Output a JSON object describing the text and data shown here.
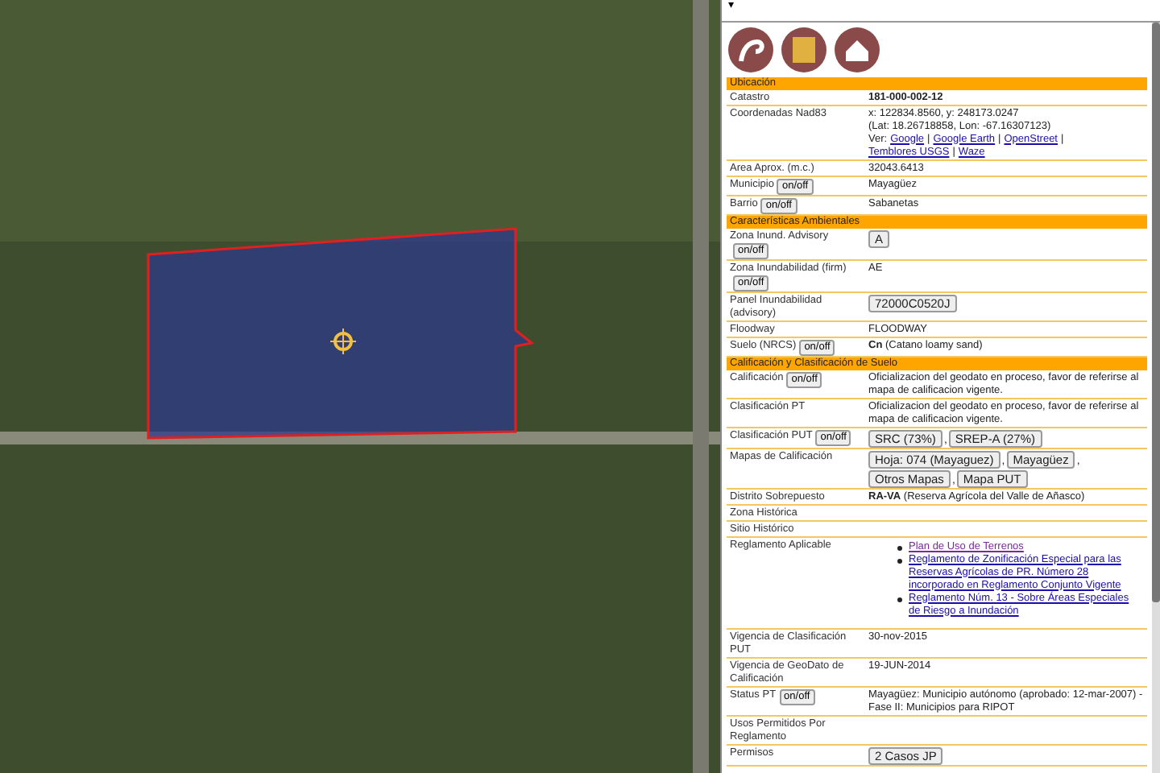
{
  "panel_toggle": "▾",
  "sections": [
    {
      "title": "Ubicación",
      "rows": [
        {
          "label": "Catastro",
          "value": "**181-000-002-12**"
        },
        {
          "label": "Coordenadas Nad83",
          "lines": [
            "x: 122834.8560, y: 248173.0247",
            "(Lat: 18.26718858, Lon: -67.16307123)"
          ],
          "inline_links": {
            "prefix": "Ver:",
            "separator": "|",
            "items": [
              "Google",
              "Google Earth",
              "OpenStreet",
              "Temblores USGS",
              "Waze"
            ]
          }
        },
        {
          "label": "Area Aprox. (m.c.)",
          "value": "32043.6413"
        },
        {
          "label": "Municipio",
          "toggle": "on/off",
          "value": "Mayagüez"
        },
        {
          "label": "Barrio",
          "toggle": "on/off",
          "value": "Sabanetas"
        }
      ]
    },
    {
      "title": "Características Ambientales",
      "rows": [
        {
          "label": "Zona Inund. Advisory",
          "toggle": "on/off",
          "buttons": [
            "A"
          ]
        },
        {
          "label": "Zona Inundabilidad (firm)",
          "toggle": "on/off",
          "value": "AE"
        },
        {
          "label": "Panel Inundabilidad (advisory)",
          "buttons": [
            "72000C0520J"
          ]
        },
        {
          "label": "Floodway",
          "value": "FLOODWAY"
        },
        {
          "label": "Suelo (NRCS)",
          "toggle": "on/off",
          "value": "**Cn** (Catano loamy sand)"
        }
      ]
    },
    {
      "title": "Calificación y Clasificación de Suelo",
      "rows": [
        {
          "label": "Calificación",
          "toggle": "on/off",
          "value": "Oficializacion del geodato en proceso, favor de referirse al mapa de calificacion vigente."
        },
        {
          "label": "Clasificación PT",
          "value": "Oficializacion del geodato en proceso, favor de referirse al mapa de calificacion vigente."
        },
        {
          "label": "Clasificación PUT",
          "toggle": "on/off",
          "buttons": [
            "SRC (73%)",
            "SREP-A (27%)"
          ],
          "button_separator": ","
        },
        {
          "label": "Mapas de Calificación",
          "buttons": [
            "Hoja: 074 (Mayaguez)",
            "Mayagüez",
            "Otros Mapas",
            "Mapa PUT"
          ],
          "button_separator": ","
        },
        {
          "label": "Distrito Sobrepuesto",
          "value": "**RA-VA** (Reserva Agrícola del Valle de Añasco)"
        },
        {
          "label": "Zona Histórica"
        },
        {
          "label": "Sitio Histórico"
        },
        {
          "label": "Reglamento Aplicable",
          "links": [
            {
              "text": "Plan de Uso de Terrenos",
              "visited": true
            },
            {
              "text": "Reglamento de Zonificación Especial para las Reservas Agrícolas de PR. Número 28 incorporado en Reglamento Conjunto Vigente",
              "visited": false
            },
            {
              "text": "Reglamento Núm. 13 - Sobre Áreas Especiales de Riesgo a Inundación",
              "visited": false
            }
          ]
        },
        {
          "label": "Vigencia de Clasificación PUT",
          "value": "30-nov-2015"
        },
        {
          "label": "Vigencia de GeoDato de Calificación",
          "value": "19-JUN-2014"
        },
        {
          "label": "Status PT",
          "toggle": "on/off",
          "value": "Mayagüez: Municipio autónomo (aprobado: 12-mar-2007) - Fase II: Municipios para RIPOT"
        },
        {
          "label": "Usos Permitidos Por Reglamento"
        },
        {
          "label": "Permisos",
          "buttons": [
            "2 Casos JP"
          ]
        }
      ]
    }
  ]
}
